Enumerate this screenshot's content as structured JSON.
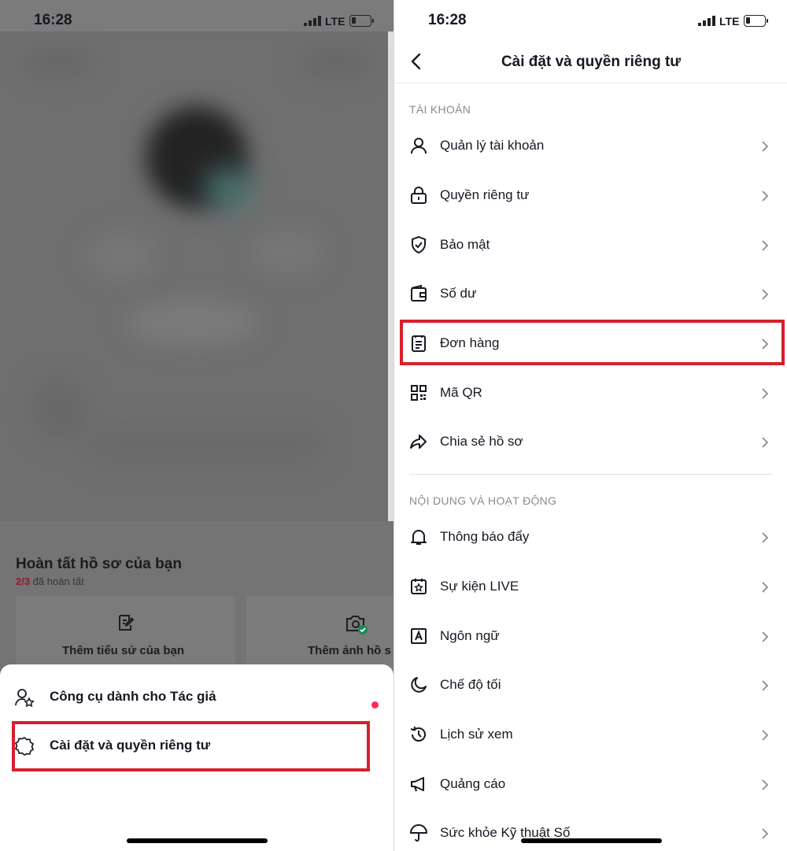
{
  "status_bar": {
    "time": "16:28",
    "network": "LTE"
  },
  "left_screen": {
    "profile_card": {
      "title": "Hoàn tất hồ sơ của bạn",
      "progress_count": "2/3",
      "progress_text": "đã hoàn tất",
      "cards": [
        {
          "label": "Thêm tiểu sử của bạn",
          "icon": "edit-note-icon"
        },
        {
          "label": "Thêm ảnh hồ s",
          "icon": "camera-check-icon"
        }
      ]
    },
    "sheet": {
      "items": [
        {
          "label": "Công cụ dành cho Tác giả",
          "icon": "creator-tools-icon",
          "has_dot": true
        },
        {
          "label": "Cài đặt và quyền riêng tư",
          "icon": "settings-gear-icon",
          "highlighted": true
        }
      ]
    }
  },
  "right_screen": {
    "title": "Cài đặt và quyền riêng tư",
    "sections": [
      {
        "header": "TÀI KHOẢN",
        "items": [
          {
            "label": "Quản lý tài khoản",
            "icon": "person-icon"
          },
          {
            "label": "Quyền riêng tư",
            "icon": "lock-icon"
          },
          {
            "label": "Bảo mật",
            "icon": "shield-check-icon"
          },
          {
            "label": "Số dư",
            "icon": "wallet-icon"
          },
          {
            "label": "Đơn hàng",
            "icon": "order-clipboard-icon",
            "highlighted": true
          },
          {
            "label": "Mã QR",
            "icon": "qr-code-icon"
          },
          {
            "label": "Chia sẻ hồ sơ",
            "icon": "share-arrow-icon"
          }
        ]
      },
      {
        "header": "NỘI DUNG VÀ HOẠT ĐỘNG",
        "items": [
          {
            "label": "Thông báo đẩy",
            "icon": "bell-icon"
          },
          {
            "label": "Sự kiện LIVE",
            "icon": "calendar-star-icon"
          },
          {
            "label": "Ngôn ngữ",
            "icon": "language-a-icon"
          },
          {
            "label": "Chế độ tối",
            "icon": "moon-icon"
          },
          {
            "label": "Lịch sử xem",
            "icon": "history-icon"
          },
          {
            "label": "Quảng cáo",
            "icon": "megaphone-icon"
          },
          {
            "label": "Sức khỏe Kỹ thuật Số",
            "icon": "umbrella-icon"
          }
        ]
      }
    ]
  },
  "colors": {
    "highlight": "#d6202c",
    "notification_dot": "#fe2c55",
    "section_header": "#8a8b91"
  }
}
